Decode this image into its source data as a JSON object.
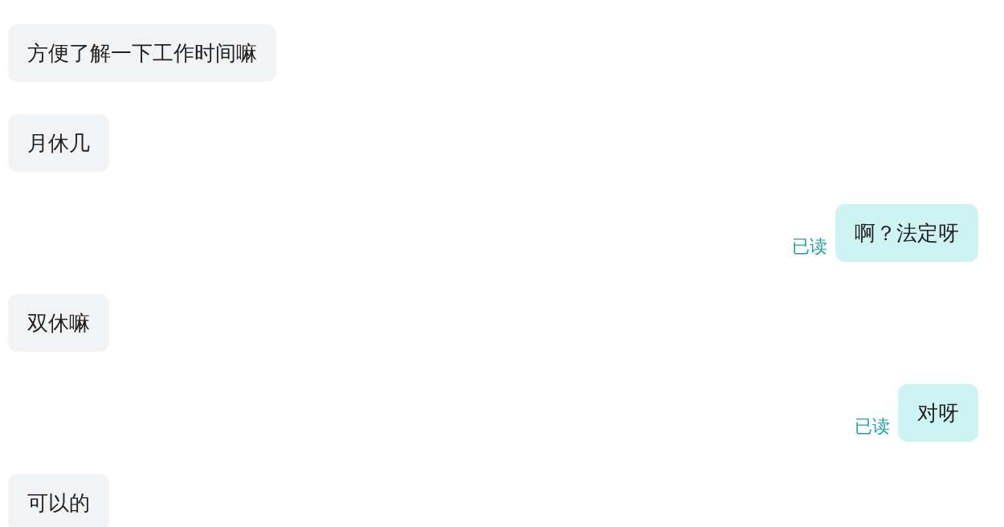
{
  "messages": [
    {
      "kind": "received",
      "text": "方便了解一下工作时间嘛"
    },
    {
      "kind": "received",
      "text": "月休几"
    },
    {
      "kind": "sent",
      "text": "啊？法定呀",
      "status": "已读"
    },
    {
      "kind": "received",
      "text": "双休嘛"
    },
    {
      "kind": "sent",
      "text": "对呀",
      "status": "已读"
    },
    {
      "kind": "received",
      "text": "可以的"
    }
  ]
}
